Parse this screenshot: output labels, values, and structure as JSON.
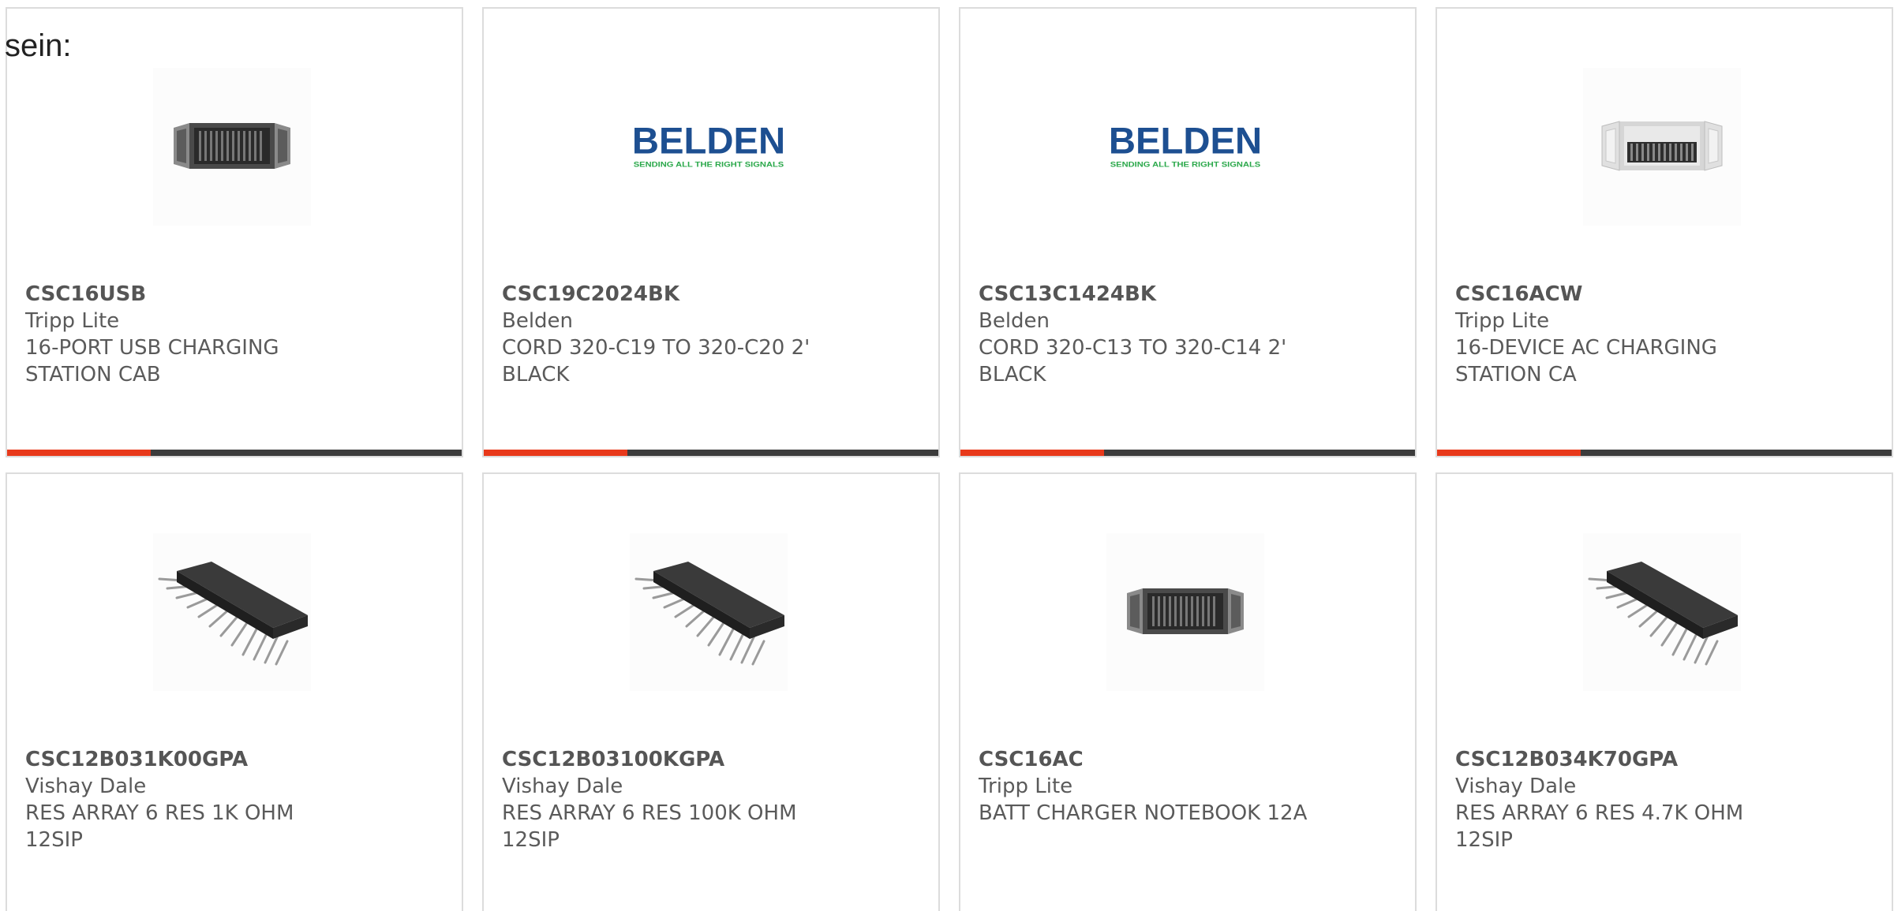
{
  "lead_text": "sein:",
  "colors": {
    "accent": "#e8391b",
    "bar": "#3c3c3c",
    "text": "#5a5a5a",
    "belden_blue": "#1d4f91",
    "belden_green": "#2aa84a"
  },
  "products": [
    {
      "part": "CSC16USB",
      "maker": "Tripp Lite",
      "desc": "16-PORT USB CHARGING STATION CAB",
      "image": "charging-cabinet-dark-icon"
    },
    {
      "part": "CSC19C2024BK",
      "maker": "Belden",
      "desc": "CORD 320-C19 TO 320-C20 2' BLACK",
      "image": "belden-logo",
      "logo_text": "BELDEN",
      "logo_tagline": "SENDING ALL THE RIGHT SIGNALS"
    },
    {
      "part": "CSC13C1424BK",
      "maker": "Belden",
      "desc": "CORD 320-C13 TO 320-C14 2' BLACK",
      "image": "belden-logo",
      "logo_text": "BELDEN",
      "logo_tagline": "SENDING ALL THE RIGHT SIGNALS"
    },
    {
      "part": "CSC16ACW",
      "maker": "Tripp Lite",
      "desc": "16-DEVICE AC CHARGING STATION CA",
      "image": "charging-cabinet-white-icon"
    },
    {
      "part": "CSC12B031K00GPA",
      "maker": "Vishay Dale",
      "desc": "RES ARRAY 6 RES 1K OHM 12SIP",
      "image": "sip-resistor-array-icon"
    },
    {
      "part": "CSC12B03100KGPA",
      "maker": "Vishay Dale",
      "desc": "RES ARRAY 6 RES 100K OHM 12SIP",
      "image": "sip-resistor-array-icon"
    },
    {
      "part": "CSC16AC",
      "maker": "Tripp Lite",
      "desc": "BATT CHARGER NOTEBOOK 12A",
      "image": "charging-cabinet-dark-icon"
    },
    {
      "part": "CSC12B034K70GPA",
      "maker": "Vishay Dale",
      "desc": "RES ARRAY 6 RES 4.7K OHM 12SIP",
      "image": "sip-resistor-array-icon"
    }
  ]
}
